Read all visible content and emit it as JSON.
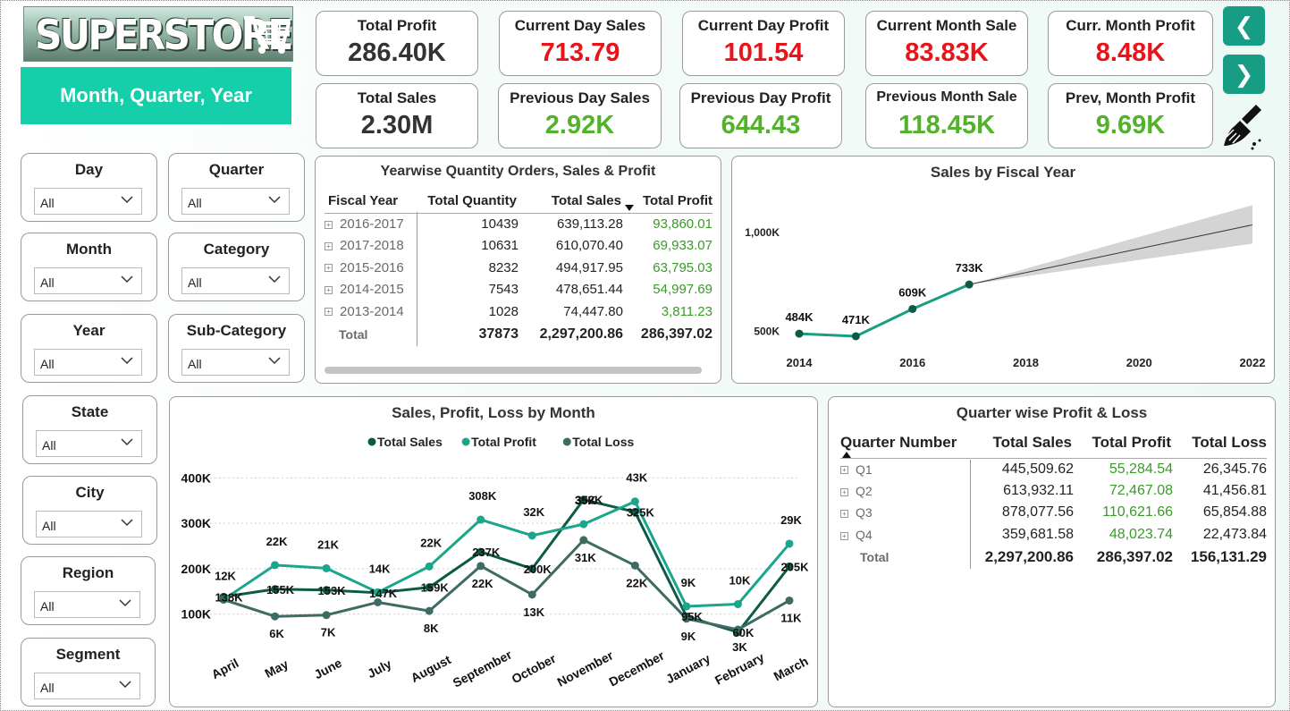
{
  "brand": {
    "name": "SUPERSTORE",
    "banner": "Month, Quarter, Year"
  },
  "kpis": [
    {
      "label": "Total Profit",
      "value": "286.40K",
      "color": "black"
    },
    {
      "label": "Current Day Sales",
      "value": "713.79",
      "color": "red"
    },
    {
      "label": "Current Day Profit",
      "value": "101.54",
      "color": "red"
    },
    {
      "label": "Current Month Sale",
      "value": "83.83K",
      "color": "red"
    },
    {
      "label": "Curr. Month Profit",
      "value": "8.48K",
      "color": "red"
    },
    {
      "label": "Total Sales",
      "value": "2.30M",
      "color": "black"
    },
    {
      "label": "Previous Day Sales",
      "value": "2.92K",
      "color": "green"
    },
    {
      "label": "Previous Day Profit",
      "value": "644.43",
      "color": "green"
    },
    {
      "label": "Previous Month Sale",
      "value": "118.45K",
      "color": "green"
    },
    {
      "label": "Prev, Month Profit",
      "value": "9.69K",
      "color": "green"
    }
  ],
  "nav": {
    "back": "❮",
    "forward": "❯",
    "clear_icon": "broom-icon"
  },
  "slicers": {
    "day": {
      "title": "Day",
      "value": "All"
    },
    "quarter": {
      "title": "Quarter",
      "value": "All"
    },
    "month": {
      "title": "Month",
      "value": "All"
    },
    "category": {
      "title": "Category",
      "value": "All"
    },
    "year": {
      "title": "Year",
      "value": "All"
    },
    "subcategory": {
      "title": "Sub-Category",
      "value": "All"
    },
    "state": {
      "title": "State",
      "value": "All"
    },
    "city": {
      "title": "City",
      "value": "All"
    },
    "region": {
      "title": "Region",
      "value": "All"
    },
    "segment": {
      "title": "Segment",
      "value": "All"
    }
  },
  "yearwise": {
    "title": "Yearwise Quantity Orders, Sales & Profit",
    "headers": [
      "Fiscal Year",
      "Total Quantity",
      "Total Sales",
      "Total Profit"
    ],
    "rows": [
      {
        "year": "2016-2017",
        "qty": "10439",
        "sales": "639,113.28",
        "profit": "93,860.01"
      },
      {
        "year": "2017-2018",
        "qty": "10631",
        "sales": "610,070.40",
        "profit": "69,933.07"
      },
      {
        "year": "2015-2016",
        "qty": "8232",
        "sales": "494,917.95",
        "profit": "63,795.03"
      },
      {
        "year": "2014-2015",
        "qty": "7543",
        "sales": "478,651.44",
        "profit": "54,997.69"
      },
      {
        "year": "2013-2014",
        "qty": "1028",
        "sales": "74,447.80",
        "profit": "3,811.23"
      }
    ],
    "total": {
      "label": "Total",
      "qty": "37873",
      "sales": "2,297,200.86",
      "profit": "286,397.02"
    }
  },
  "quarterwise": {
    "title": "Quarter wise Profit & Loss",
    "headers": [
      "Quarter Number",
      "Total Sales",
      "Total Profit",
      "Total Loss"
    ],
    "rows": [
      {
        "q": "Q1",
        "sales": "445,509.62",
        "profit": "55,284.54",
        "loss": "26,345.76"
      },
      {
        "q": "Q2",
        "sales": "613,932.11",
        "profit": "72,467.08",
        "loss": "41,456.81"
      },
      {
        "q": "Q3",
        "sales": "878,077.56",
        "profit": "110,621.66",
        "loss": "65,854.88"
      },
      {
        "q": "Q4",
        "sales": "359,681.58",
        "profit": "48,023.74",
        "loss": "22,473.84"
      }
    ],
    "total": {
      "label": "Total",
      "sales": "2,297,200.86",
      "profit": "286,397.02",
      "loss": "156,131.29"
    }
  },
  "chart_data": [
    {
      "type": "line",
      "title": "Sales by Fiscal Year",
      "x": [
        2014,
        2015,
        2016,
        2017
      ],
      "values": [
        484,
        471,
        609,
        733
      ],
      "data_labels": [
        "484K",
        "471K",
        "609K",
        "733K"
      ],
      "forecast": {
        "x": [
          2017,
          2022
        ],
        "values": [
          733,
          1035
        ],
        "band_low": [
          733,
          940
        ],
        "band_high": [
          733,
          1135
        ]
      },
      "x_ticks": [
        "2014",
        "2016",
        "2018",
        "2020",
        "2022"
      ],
      "y_ticks": [
        "500K",
        "1,000K"
      ],
      "xlim": [
        2014,
        2022
      ],
      "ylim": [
        430,
        1200
      ],
      "grid": false,
      "colors": {
        "line": "#1a9e80",
        "forecast": "#333333",
        "band": "#d4d4d4"
      }
    },
    {
      "type": "line",
      "title": "Sales, Profit, Loss by Month",
      "categories": [
        "April",
        "May",
        "June",
        "July",
        "August",
        "September",
        "October",
        "November",
        "December",
        "January",
        "February",
        "March"
      ],
      "series": [
        {
          "name": "Total Sales",
          "color": "#0c5a47",
          "values": [
            138,
            155,
            153,
            147,
            159,
            237,
            200,
            352,
            325,
            95,
            60,
            205
          ],
          "labels": [
            "138K",
            "155K",
            "153K",
            "147K",
            "159K",
            "237K",
            "200K",
            "352K",
            "325K",
            "95K",
            "60K",
            "205K"
          ]
        },
        {
          "name": "Total Profit",
          "color": "#19a68a",
          "values": [
            132,
            208,
            201,
            148,
            205,
            308,
            273,
            298,
            348,
            117,
            122,
            255
          ],
          "labels": [
            "12K",
            "22K",
            "21K",
            "14K",
            "22K",
            "308K",
            "32K",
            "35K",
            "43K",
            "9K",
            "10K",
            "29K"
          ]
        },
        {
          "name": "Total Loss",
          "color": "#3e6b64",
          "values": [
            132,
            95,
            98,
            126,
            107,
            206,
            143,
            263,
            207,
            90,
            66,
            130
          ],
          "labels": [
            "",
            "6K",
            "7K",
            "",
            "8K",
            "22K",
            "13K",
            "31K",
            "22K",
            "9K",
            "3K",
            "11K"
          ]
        }
      ],
      "y_ticks": [
        "100K",
        "200K",
        "300K",
        "400K"
      ],
      "ylim": [
        60,
        440
      ],
      "legend_position": "top",
      "grid": true
    }
  ]
}
